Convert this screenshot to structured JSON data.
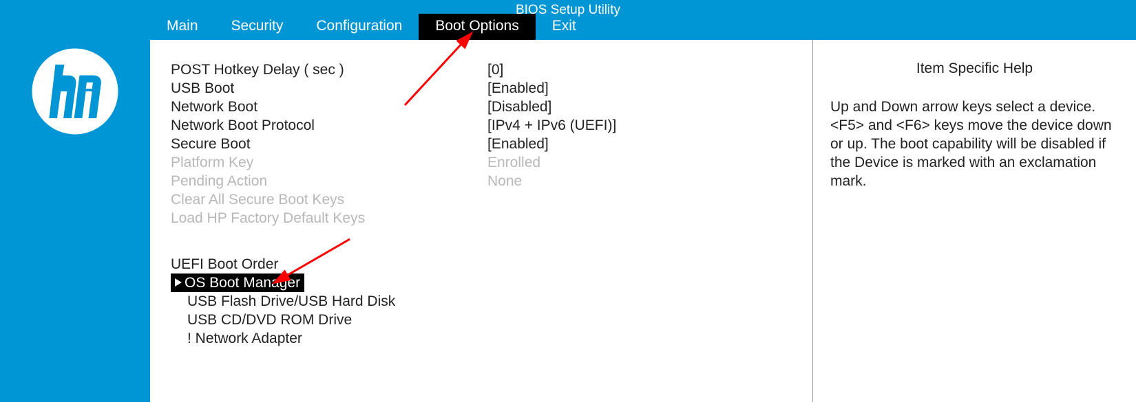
{
  "title": "BIOS Setup Utility",
  "tabs": {
    "main": "Main",
    "security": "Security",
    "configuration": "Configuration",
    "boot_options": "Boot Options",
    "exit": "Exit"
  },
  "settings": {
    "post_hotkey_delay": {
      "label": "POST Hotkey Delay ( sec )",
      "value": "[0]"
    },
    "usb_boot": {
      "label": "USB Boot",
      "value": "[Enabled]"
    },
    "network_boot": {
      "label": "Network Boot",
      "value": "[Disabled]"
    },
    "network_boot_proto": {
      "label": "Network Boot Protocol",
      "value": "[IPv4 + IPv6 (UEFI)]"
    },
    "secure_boot": {
      "label": "Secure Boot",
      "value": "[Enabled]"
    },
    "platform_key": {
      "label": "Platform Key",
      "value": "Enrolled"
    },
    "pending_action": {
      "label": "Pending Action",
      "value": "None"
    },
    "clear_sb_keys": {
      "label": "Clear All Secure Boot Keys"
    },
    "load_hp_keys": {
      "label": "Load HP Factory Default Keys"
    }
  },
  "boot_order_header": "UEFI Boot Order",
  "boot_order": {
    "os_boot_manager": "OS Boot Manager",
    "usb_flash": "USB Flash Drive/USB Hard Disk",
    "usb_cd": "USB CD/DVD ROM Drive",
    "network": "! Network Adapter"
  },
  "help": {
    "title": "Item Specific Help",
    "body": "Up and Down arrow keys select a device. <F5> and <F6> keys move the device down or up.\nThe boot capability will be disabled if the Device is marked with an exclamation mark."
  }
}
